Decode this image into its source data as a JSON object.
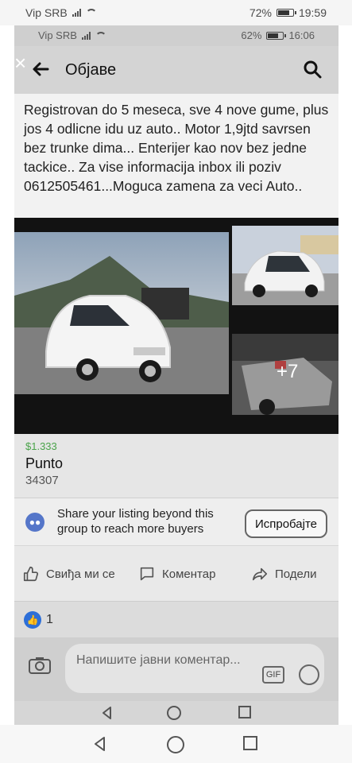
{
  "outer_status": {
    "carrier": "Vip SRB",
    "battery": "72%",
    "battery_level": 0.72,
    "time": "19:59"
  },
  "inner_status": {
    "carrier": "Vip SRB",
    "battery": "62%",
    "battery_level": 0.62,
    "time": "16:06"
  },
  "header": {
    "title": "Објаве",
    "back_icon": "arrow-left-icon",
    "search_icon": "search-icon",
    "close_icon": "close-icon"
  },
  "post": {
    "text": "Registrovan do 5 meseca, sve 4 nove gume, plus jos 4 odlicne idu uz auto.. Motor 1,9jtd savrsen bez trunke dima... Enterijer kao nov bez jedne tackice.. Za vise informacija inbox ili poziv 0612505461...Moguca zamena za veci Auto.."
  },
  "photos": {
    "more_count": "+7"
  },
  "listing": {
    "price": "$1.333",
    "title": "Punto",
    "subtitle": "34307"
  },
  "share": {
    "text": "Share your listing beyond this group to reach more buyers",
    "button_label": "Испробајте"
  },
  "actions": {
    "like_label": "Свиђа ми се",
    "comment_label": "Коментар",
    "share_label": "Подели"
  },
  "reactions": {
    "count": "1"
  },
  "composer": {
    "placeholder": "Напишите јавни коментар..."
  },
  "colors": {
    "price_green": "#4aa34a",
    "like_blue": "#2d6fd8"
  }
}
